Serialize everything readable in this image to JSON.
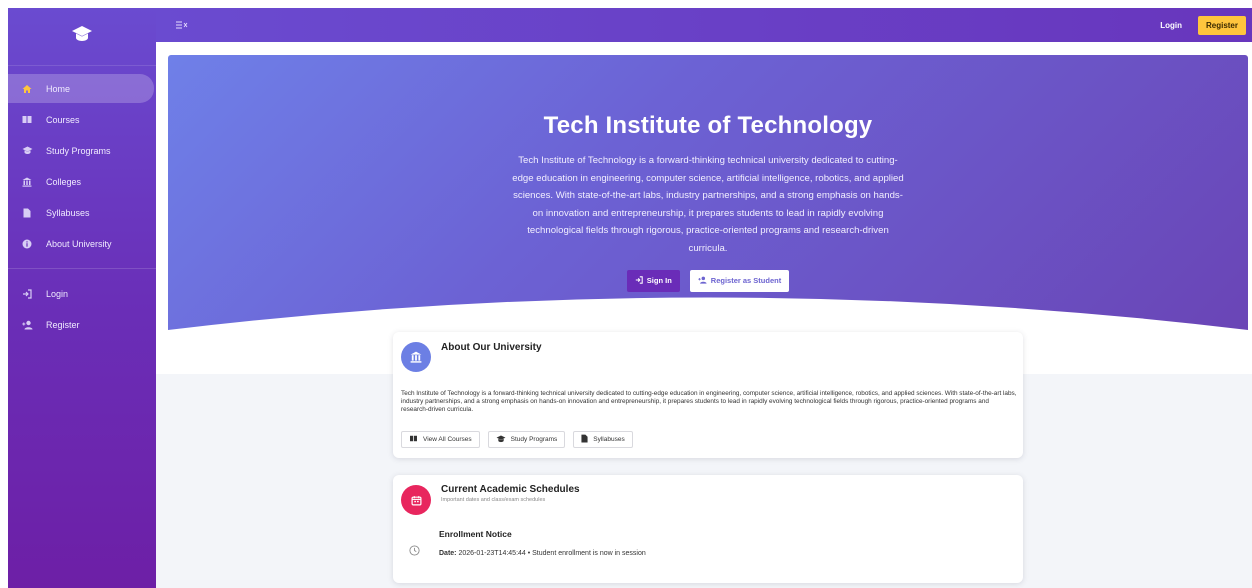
{
  "colors": {
    "sidebar_top": "#6a4bd0",
    "sidebar_bottom": "#6d1fa6",
    "accent_yellow": "#ffc53d",
    "about_icon_bg": "#6c7fe4",
    "schedule_icon_bg": "#e8265e"
  },
  "sidebar": {
    "logo_icon": "graduation-cap-icon",
    "items": [
      {
        "label": "Home",
        "icon": "home-icon",
        "active": true
      },
      {
        "label": "Courses",
        "icon": "book-icon"
      },
      {
        "label": "Study Programs",
        "icon": "graduation-cap-icon"
      },
      {
        "label": "Colleges",
        "icon": "building-icon"
      },
      {
        "label": "Syllabuses",
        "icon": "file-icon"
      },
      {
        "label": "About University",
        "icon": "info-icon"
      }
    ],
    "auth_items": [
      {
        "label": "Login",
        "icon": "sign-in-icon"
      },
      {
        "label": "Register",
        "icon": "user-plus-icon"
      }
    ]
  },
  "topbar": {
    "login_label": "Login",
    "register_label": "Register"
  },
  "hero": {
    "title": "Tech Institute of Technology",
    "description": "Tech Institute of Technology is a forward-thinking technical university dedicated to cutting-edge education in engineering, computer science, artificial intelligence, robotics, and applied sciences. With state-of-the-art labs, industry partnerships, and a strong emphasis on hands-on innovation and entrepreneurship, it prepares students to lead in rapidly evolving technological fields through rigorous, practice-oriented programs and research-driven curricula.",
    "signin_label": "Sign In",
    "register_student_label": "Register as Student"
  },
  "about": {
    "title": "About Our University",
    "text": "Tech Institute of Technology is a forward-thinking technical university dedicated to cutting-edge education in engineering, computer science, artificial intelligence, robotics, and applied sciences. With state-of-the-art labs, industry partnerships, and a strong emphasis on hands-on innovation and entrepreneurship, it prepares students to lead in rapidly evolving technological fields through rigorous, practice-oriented programs and research-driven curricula.",
    "buttons": {
      "courses": "View All Courses",
      "programs": "Study Programs",
      "syllabuses": "Syllabuses"
    }
  },
  "schedules": {
    "title": "Current Academic Schedules",
    "subtitle": "Important dates and class/exam schedules",
    "notice_title": "Enrollment Notice",
    "date_label": "Date:",
    "date_value": "2026-01-23T14:45:44 • Student enrollment is now in session"
  }
}
